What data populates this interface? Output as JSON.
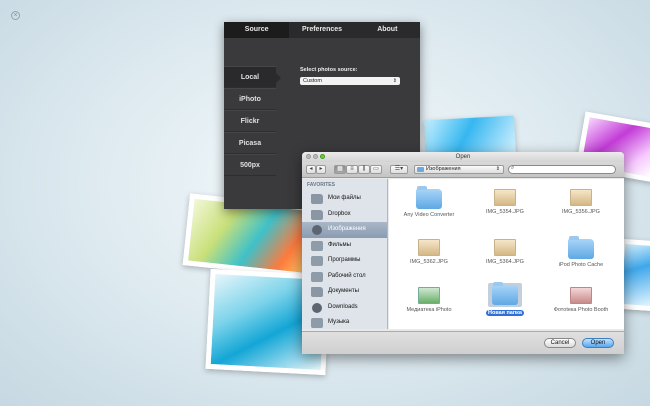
{
  "colors": {
    "accent": "#2f6fd6",
    "dark_window": "#3a3a3c"
  },
  "source_window": {
    "tabs": [
      "Source",
      "Preferences",
      "About"
    ],
    "sidebar": [
      "Local",
      "iPhoto",
      "Flickr",
      "Picasa",
      "500px"
    ],
    "select_label": "Select photos source:",
    "select_value": "Custom"
  },
  "dialog": {
    "title": "Open",
    "path": "Изображения",
    "favorites_header": "FAVORITES",
    "favorites": [
      {
        "label": "Мои файлы",
        "icon": "files-icon"
      },
      {
        "label": "Dropbox",
        "icon": "dropbox-icon"
      },
      {
        "label": "Изображения",
        "icon": "pictures-icon"
      },
      {
        "label": "Фильмы",
        "icon": "movies-icon"
      },
      {
        "label": "Программы",
        "icon": "applications-icon"
      },
      {
        "label": "Рабочий стол",
        "icon": "desktop-icon"
      },
      {
        "label": "Документы",
        "icon": "documents-icon"
      },
      {
        "label": "Downloads",
        "icon": "downloads-icon"
      },
      {
        "label": "Музыка",
        "icon": "music-icon"
      }
    ],
    "files": [
      {
        "name": "Any Video Converter",
        "type": "folder"
      },
      {
        "name": "IMG_5354.JPG",
        "type": "image"
      },
      {
        "name": "IMG_5356.JPG",
        "type": "image"
      },
      {
        "name": "IMG_5362.JPG",
        "type": "image"
      },
      {
        "name": "IMG_5364.JPG",
        "type": "image"
      },
      {
        "name": "iPod Photo Cache",
        "type": "folder"
      },
      {
        "name": "Медиатека iPhoto",
        "type": "library"
      },
      {
        "name": "Новая папка",
        "type": "folder",
        "selected": true
      },
      {
        "name": "Фотоteка Photo Booth",
        "type": "library"
      }
    ],
    "cancel_label": "Cancel",
    "open_label": "Open"
  }
}
